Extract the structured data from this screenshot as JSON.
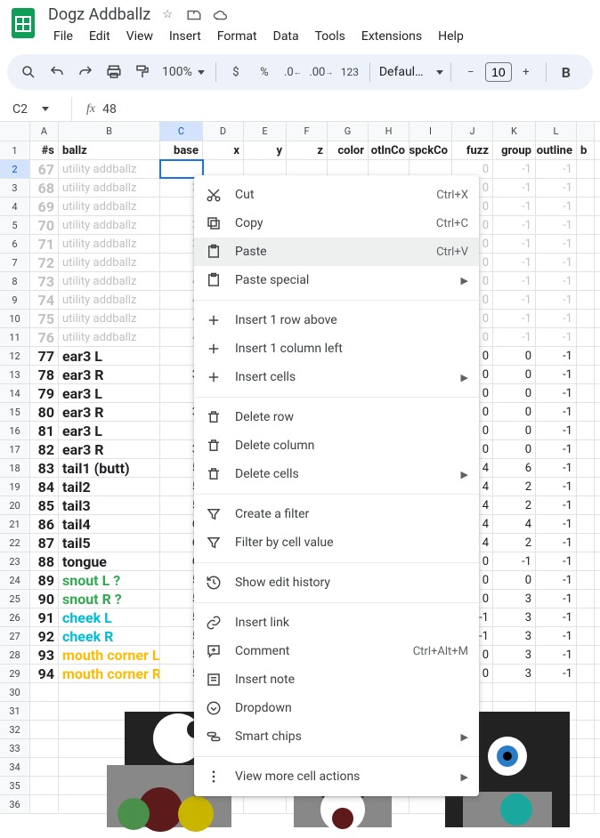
{
  "doc": {
    "title": "Dogz Addballz"
  },
  "menubar": [
    "File",
    "Edit",
    "View",
    "Insert",
    "Format",
    "Data",
    "Tools",
    "Extensions",
    "Help"
  ],
  "toolbar": {
    "zoom": "100%",
    "font": "Defaul…",
    "fontsize": "10"
  },
  "namebox": {
    "ref": "C2",
    "formula": "48"
  },
  "columns": [
    "",
    "A",
    "B",
    "C",
    "D",
    "E",
    "F",
    "G",
    "H",
    "I",
    "J",
    "K",
    "L",
    ""
  ],
  "colhead": [
    "#s",
    "ballz",
    "base",
    "x",
    "y",
    "z",
    "color",
    "otlnCo",
    "spckCo",
    "fuzz",
    "group",
    "outline",
    "b"
  ],
  "rows": [
    {
      "n": 1,
      "header": true
    },
    {
      "n": 2,
      "dim": true,
      "a": "67",
      "b": "utility addballz",
      "c": "",
      "d": "",
      "e": "",
      "f": "",
      "g": "",
      "h": "",
      "i": "",
      "j": "0",
      "k": "-1",
      "l": "-1"
    },
    {
      "n": 3,
      "dim": true,
      "a": "68",
      "b": "utility addballz",
      "c": "3",
      "j": "0",
      "k": "-1",
      "l": "-1"
    },
    {
      "n": 4,
      "dim": true,
      "a": "69",
      "b": "utility addballz",
      "c": "",
      "j": "0",
      "k": "-1",
      "l": "-1"
    },
    {
      "n": 5,
      "dim": true,
      "a": "70",
      "b": "utility addballz",
      "c": "3",
      "j": "0",
      "k": "-1",
      "l": "-1"
    },
    {
      "n": 6,
      "dim": true,
      "a": "71",
      "b": "utility addballz",
      "c": "3",
      "j": "0",
      "k": "-1",
      "l": "-1"
    },
    {
      "n": 7,
      "dim": true,
      "a": "72",
      "b": "utility addballz",
      "c": "",
      "j": "0",
      "k": "-1",
      "l": "-1"
    },
    {
      "n": 8,
      "dim": true,
      "a": "73",
      "b": "utility addballz",
      "c": "4",
      "j": "0",
      "k": "-1",
      "l": "-1"
    },
    {
      "n": 9,
      "dim": true,
      "a": "74",
      "b": "utility addballz",
      "c": "4",
      "j": "0",
      "k": "-1",
      "l": "-1"
    },
    {
      "n": 10,
      "dim": true,
      "a": "75",
      "b": "utility addballz",
      "c": "4",
      "j": "0",
      "k": "-1",
      "l": "-1"
    },
    {
      "n": 11,
      "dim": true,
      "a": "76",
      "b": "utility addballz",
      "c": "4",
      "j": "0",
      "k": "-1",
      "l": "-1"
    },
    {
      "n": 12,
      "a": "77",
      "b": "ear3 L",
      "c": "",
      "j": "0",
      "k": "0",
      "l": "-1"
    },
    {
      "n": 13,
      "a": "78",
      "b": "ear3 R",
      "c": "3",
      "j": "0",
      "k": "0",
      "l": "-1"
    },
    {
      "n": 14,
      "a": "79",
      "b": "ear3 L",
      "c": "",
      "j": "0",
      "k": "0",
      "l": "-1"
    },
    {
      "n": 15,
      "a": "80",
      "b": "ear3 R",
      "c": "3",
      "j": "0",
      "k": "0",
      "l": "-1"
    },
    {
      "n": 16,
      "a": "81",
      "b": "ear3 L",
      "c": "",
      "j": "0",
      "k": "0",
      "l": "-1"
    },
    {
      "n": 17,
      "a": "82",
      "b": "ear3 R",
      "c": "3",
      "j": "0",
      "k": "0",
      "l": "-1"
    },
    {
      "n": 18,
      "a": "83",
      "b": "tail1 (butt)",
      "c": "5",
      "j": "4",
      "k": "6",
      "l": "-1"
    },
    {
      "n": 19,
      "a": "84",
      "b": "tail2",
      "c": "5",
      "j": "4",
      "k": "2",
      "l": "-1"
    },
    {
      "n": 20,
      "a": "85",
      "b": "tail3",
      "c": "5",
      "j": "4",
      "k": "2",
      "l": "-1"
    },
    {
      "n": 21,
      "a": "86",
      "b": "tail4",
      "c": "6",
      "j": "4",
      "k": "4",
      "l": "-1"
    },
    {
      "n": 22,
      "a": "87",
      "b": "tail5",
      "c": "6",
      "j": "4",
      "k": "2",
      "l": "-1"
    },
    {
      "n": 23,
      "a": "88",
      "b": "tongue",
      "c": "6",
      "j": "0",
      "k": "-1",
      "l": "-1"
    },
    {
      "n": 24,
      "a": "89",
      "b": "snout L ?",
      "c": "5",
      "cls": "snout",
      "j": "0",
      "k": "0",
      "l": "-1"
    },
    {
      "n": 25,
      "a": "90",
      "b": "snout R ?",
      "c": "5",
      "cls": "snout",
      "j": "0",
      "k": "3",
      "l": "-1"
    },
    {
      "n": 26,
      "a": "91",
      "b": "cheek L",
      "c": "5",
      "cls": "cheek",
      "j": "-1",
      "k": "3",
      "l": "-1"
    },
    {
      "n": 27,
      "a": "92",
      "b": "cheek R",
      "c": "5",
      "cls": "cheek",
      "j": "-1",
      "k": "3",
      "l": "-1"
    },
    {
      "n": 28,
      "a": "93",
      "b": "mouth corner L",
      "c": "5",
      "cls": "mouth",
      "j": "0",
      "k": "3",
      "l": "-1"
    },
    {
      "n": 29,
      "a": "94",
      "b": "mouth corner R",
      "c": "5",
      "cls": "mouth",
      "j": "0",
      "k": "3",
      "l": "-1"
    },
    {
      "n": 30
    },
    {
      "n": 31
    },
    {
      "n": 32
    },
    {
      "n": 33
    },
    {
      "n": 34
    },
    {
      "n": 35
    },
    {
      "n": 36
    }
  ],
  "contextMenu": {
    "items": [
      {
        "icon": "cut",
        "label": "Cut",
        "shortcut": "Ctrl+X"
      },
      {
        "icon": "copy",
        "label": "Copy",
        "shortcut": "Ctrl+C"
      },
      {
        "icon": "paste",
        "label": "Paste",
        "shortcut": "Ctrl+V",
        "hover": true
      },
      {
        "icon": "paste",
        "label": "Paste special",
        "submenu": true
      },
      {
        "sep": true
      },
      {
        "icon": "plus",
        "label": "Insert 1 row above"
      },
      {
        "icon": "plus",
        "label": "Insert 1 column left"
      },
      {
        "icon": "plus",
        "label": "Insert cells",
        "submenu": true
      },
      {
        "sep": true
      },
      {
        "icon": "trash",
        "label": "Delete row"
      },
      {
        "icon": "trash",
        "label": "Delete column"
      },
      {
        "icon": "trash",
        "label": "Delete cells",
        "submenu": true
      },
      {
        "sep": true
      },
      {
        "icon": "filter",
        "label": "Create a filter"
      },
      {
        "icon": "filter",
        "label": "Filter by cell value"
      },
      {
        "sep": true
      },
      {
        "icon": "history",
        "label": "Show edit history"
      },
      {
        "sep": true
      },
      {
        "icon": "link",
        "label": "Insert link"
      },
      {
        "icon": "comment",
        "label": "Comment",
        "shortcut": "Ctrl+Alt+M"
      },
      {
        "icon": "note",
        "label": "Insert note"
      },
      {
        "icon": "dropdown",
        "label": "Dropdown"
      },
      {
        "icon": "chips",
        "label": "Smart chips",
        "submenu": true
      },
      {
        "sep": true
      },
      {
        "icon": "more",
        "label": "View more cell actions",
        "submenu": true
      }
    ]
  }
}
